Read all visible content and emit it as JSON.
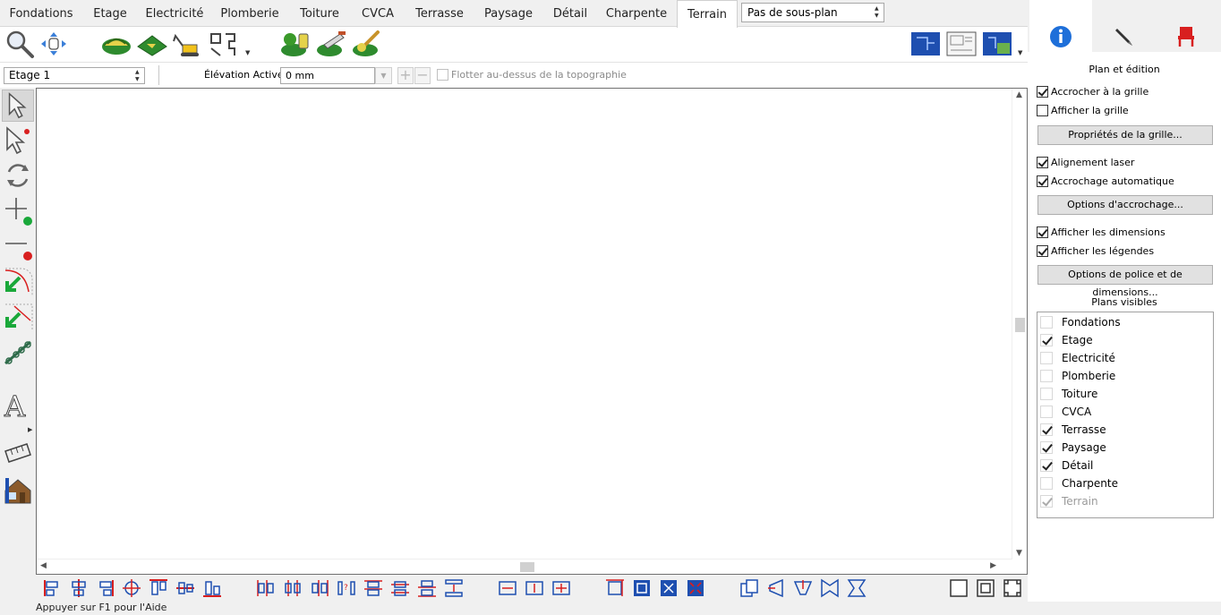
{
  "tabs": [
    {
      "label": "Fondations",
      "active": false
    },
    {
      "label": "Etage",
      "active": false
    },
    {
      "label": "Electricité",
      "active": false
    },
    {
      "label": "Plomberie",
      "active": false
    },
    {
      "label": "Toiture",
      "active": false
    },
    {
      "label": "CVCA",
      "active": false
    },
    {
      "label": "Terrasse",
      "active": false
    },
    {
      "label": "Paysage",
      "active": false
    },
    {
      "label": "Détail",
      "active": false
    },
    {
      "label": "Charpente",
      "active": false
    },
    {
      "label": "Terrain",
      "active": true
    }
  ],
  "subplan": {
    "value": "Pas de sous-plan"
  },
  "levelbar": {
    "level": "Etage 1",
    "elevation_label": "Élévation Active:",
    "elevation_value": "0 mm",
    "float_label": "Flotter au-dessus de la topographie"
  },
  "status": {
    "text": "Appuyer sur F1 pour l'Aide"
  },
  "panel": {
    "section_title": "Plan et édition",
    "snap_grid": "Accrocher à la grille",
    "show_grid": "Afficher la grille",
    "grid_props_btn": "Propriétés de la grille...",
    "laser": "Alignement laser",
    "auto_snap": "Accrochage automatique",
    "snap_options_btn": "Options d'accrochage...",
    "show_dims": "Afficher les dimensions",
    "show_legends": "Afficher les légendes",
    "font_btn": "Options de police et de dimensions...",
    "visible_title": "Plans visibles",
    "plans": [
      {
        "label": "Fondations",
        "checked": false
      },
      {
        "label": "Etage",
        "checked": true
      },
      {
        "label": "Electricité",
        "checked": false
      },
      {
        "label": "Plomberie",
        "checked": false
      },
      {
        "label": "Toiture",
        "checked": false
      },
      {
        "label": "CVCA",
        "checked": false
      },
      {
        "label": "Terrasse",
        "checked": true
      },
      {
        "label": "Paysage",
        "checked": true
      },
      {
        "label": "Détail",
        "checked": true
      },
      {
        "label": "Charpente",
        "checked": false
      },
      {
        "label": "Terrain",
        "checked": true,
        "disabled": true
      }
    ]
  },
  "colors": {
    "accent_blue": "#1e6fd9",
    "green": "#3a9a2a",
    "red": "#d81f1f"
  }
}
